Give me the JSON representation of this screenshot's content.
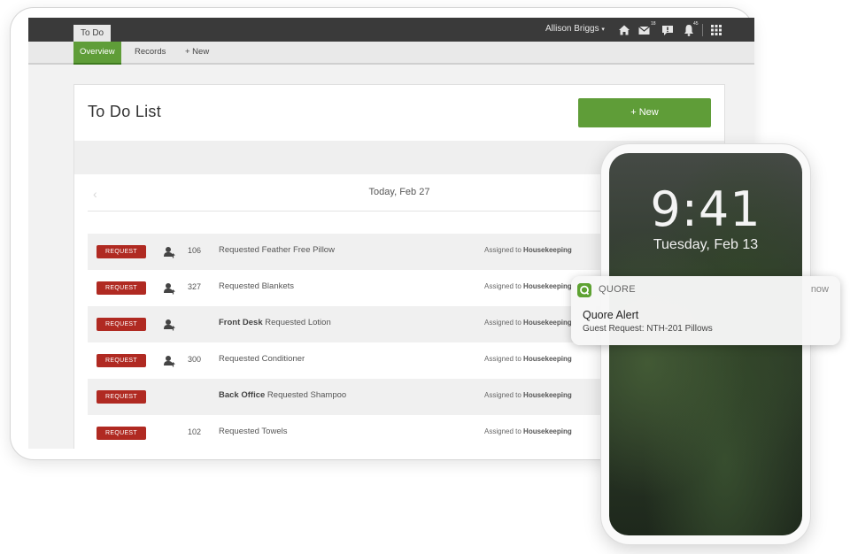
{
  "header": {
    "tab_label": "To Do",
    "user_name": "Allison Briggs",
    "user_caret": "▾",
    "mail_count": "18",
    "alert_count": "45"
  },
  "subnav": {
    "items": [
      {
        "label": "Overview",
        "active": true
      },
      {
        "label": "Records",
        "active": false
      },
      {
        "label": "+ New",
        "active": false
      }
    ]
  },
  "page": {
    "title": "To Do List",
    "new_button_label": "+ New",
    "date_label": "Today, Feb 27"
  },
  "todo_rows": [
    {
      "badge": "REQUEST",
      "has_person": true,
      "room": "106",
      "location": "",
      "description": "Requested Feather Free Pillow",
      "assigned_prefix": "Assigned to",
      "assignee": "Housekeeping"
    },
    {
      "badge": "REQUEST",
      "has_person": true,
      "room": "327",
      "location": "",
      "description": "Requested Blankets",
      "assigned_prefix": "Assigned to",
      "assignee": "Housekeeping"
    },
    {
      "badge": "REQUEST",
      "has_person": true,
      "room": "",
      "location": "Front Desk",
      "description": "Requested Lotion",
      "assigned_prefix": "Assigned to",
      "assignee": "Housekeeping"
    },
    {
      "badge": "REQUEST",
      "has_person": true,
      "room": "300",
      "location": "",
      "description": "Requested Conditioner",
      "assigned_prefix": "Assigned to",
      "assignee": "Housekeeping"
    },
    {
      "badge": "REQUEST",
      "has_person": false,
      "room": "",
      "location": "Back Office",
      "description": "Requested Shampoo",
      "assigned_prefix": "Assigned to",
      "assignee": "Housekeeping"
    },
    {
      "badge": "REQUEST",
      "has_person": false,
      "room": "102",
      "location": "",
      "description": "Requested Towels",
      "assigned_prefix": "Assigned to",
      "assignee": "Housekeeping"
    }
  ],
  "phone": {
    "time": "9:41",
    "date": "Tuesday, Feb 13"
  },
  "notification": {
    "app_name": "QUORE",
    "when": "now",
    "title": "Quore Alert",
    "body": "Guest Request: NTH-201 Pillows"
  },
  "colors": {
    "brand_green": "#5f9d38",
    "request_red": "#b02a22",
    "topbar": "#3a3a3a"
  },
  "icons": [
    "home-icon",
    "mail-icon",
    "chat-icon",
    "bell-icon",
    "apps-grid-icon",
    "person-arrow-icon",
    "chevron-left-icon",
    "quore-app-icon"
  ]
}
